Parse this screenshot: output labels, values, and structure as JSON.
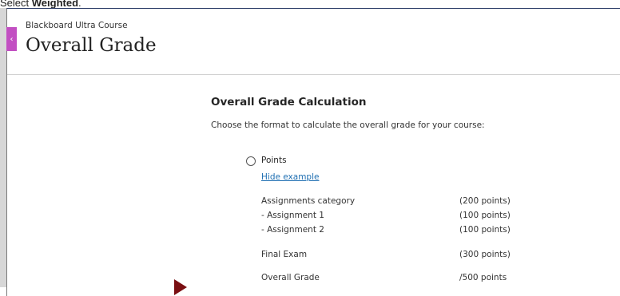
{
  "caption": {
    "prefix": "Select ",
    "bold": "Weighted",
    "suffix": "."
  },
  "header": {
    "course_name": "Blackboard Ultra Course",
    "page_title": "Overall Grade",
    "panel_toggle_glyph": "‹"
  },
  "calculation": {
    "section_title": "Overall Grade Calculation",
    "instructions": "Choose the format to calculate the overall grade for your course:",
    "option_points_label": "Points",
    "option_points_selected": false,
    "hide_example_link": "Hide example",
    "example_rows": [
      {
        "label": "Assignments category",
        "value": "(200 points)"
      },
      {
        "label": "- Assignment 1",
        "value": "(100 points)"
      },
      {
        "label": "- Assignment 2",
        "value": "(100 points)"
      },
      {
        "label": "Final Exam",
        "value": "(300 points)"
      },
      {
        "label": "Overall Grade",
        "value": "/500 points"
      }
    ]
  }
}
